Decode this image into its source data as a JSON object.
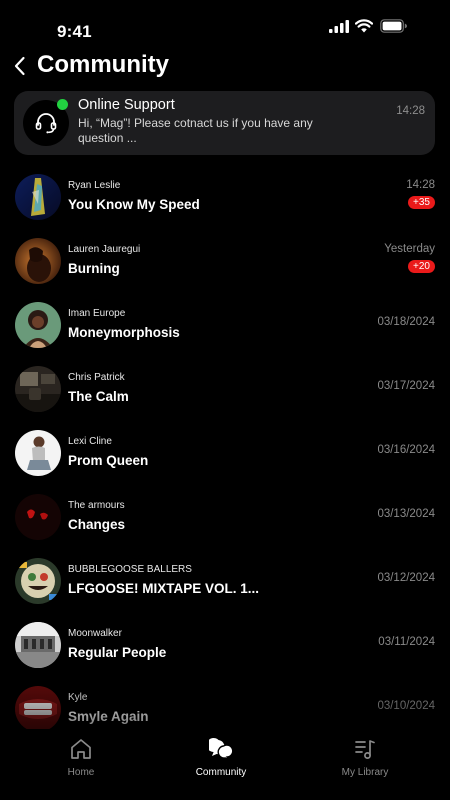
{
  "status_bar": {
    "time": "9:41"
  },
  "header": {
    "title": "Community"
  },
  "support": {
    "title": "Online Support",
    "message": "Hi, “Mag”! Please cotnact us if you have any question ...",
    "time": "14:28"
  },
  "chats": [
    {
      "artist": "Ryan Leslie",
      "title": "You Know My Speed",
      "date": "14:28",
      "badge": "+35"
    },
    {
      "artist": "Lauren Jauregui",
      "title": "Burning",
      "date": "Yesterday",
      "badge": "+20"
    },
    {
      "artist": "Iman Europe",
      "title": "Moneymorphosis",
      "date": "03/18/2024"
    },
    {
      "artist": "Chris Patrick",
      "title": "The Calm",
      "date": "03/17/2024"
    },
    {
      "artist": "Lexi Cline",
      "title": "Prom Queen",
      "date": "03/16/2024"
    },
    {
      "artist": "The armours",
      "title": "Changes",
      "date": "03/13/2024"
    },
    {
      "artist": "BUBBLEGOOSE BALLERS",
      "title": "LFGOOSE! MIXTAPE VOL. 1...",
      "date": "03/12/2024"
    },
    {
      "artist": "Moonwalker",
      "title": "Regular People",
      "date": "03/11/2024"
    },
    {
      "artist": "Kyle",
      "title": "Smyle Again",
      "date": "03/10/2024"
    }
  ],
  "tabs": [
    {
      "label": "Home",
      "icon": "home-icon",
      "active": false
    },
    {
      "label": "Community",
      "icon": "chat-bubbles-icon",
      "active": true
    },
    {
      "label": "My Library",
      "icon": "music-library-icon",
      "active": false
    }
  ],
  "colors": {
    "background": "#000000",
    "card": "#1d1d1f",
    "badge": "#ea1a1a",
    "online": "#22d141"
  }
}
